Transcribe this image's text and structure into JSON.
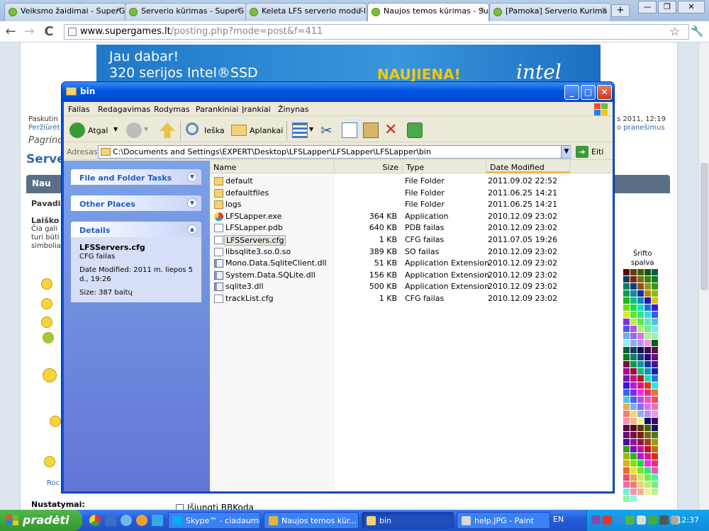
{
  "browser": {
    "tabs": [
      {
        "label": "Veiksmo žaidimai - SuperG",
        "active": false
      },
      {
        "label": "Serverio kūrimas - SuperG",
        "active": false
      },
      {
        "label": "Keleta LFS serverio modu-l",
        "active": false
      },
      {
        "label": "Naujos temos kūrimas - Su",
        "active": true
      },
      {
        "label": "[Pamoka] Serverio Kurima",
        "active": false
      }
    ],
    "newtab": "+",
    "window_min": "—",
    "window_max": "❐",
    "window_close": "✕",
    "back": "←",
    "forward": "→",
    "reload": "C",
    "url_host": "www.supergames.lt",
    "url_path": "/posting.php?mode=post&f=411",
    "star": "☆",
    "wrench": "🔧"
  },
  "page": {
    "banner_line1": "Jau dabar!",
    "banner_line2": "320 serijos Intel®SSD",
    "banner_naujiena": "NAUJIENA!",
    "banner_brand": "intel",
    "paskut": "Paskutin",
    "perziuret": "Peržiūrėt",
    "pagrind": "Pagrind",
    "datetime_right": "s 2011, 12:19",
    "pranesimus": "o pranešimus",
    "server_heading": "Server",
    "bar_label": "Nau",
    "pavad": "Pavadi",
    "laisko": "Laiško",
    "cia_gali": "Čia gali",
    "turi_buti": "turi būti",
    "simbolia": "simbolia",
    "roc": "Roc",
    "srifto": "Šrifto",
    "spalva": "spalva",
    "nustatymai": "Nustatymai:",
    "bbkoda": "Išjungti BBKodą"
  },
  "explorer": {
    "title": "bin",
    "menu": [
      "Failas",
      "Redagavimas",
      "Rodymas",
      "Parankiniai",
      "Įrankiai",
      "Žinynas"
    ],
    "toolbar": {
      "back": "Atgal",
      "search": "Ieška",
      "folders": "Aplankai"
    },
    "address_label": "Adresas",
    "address": "C:\\Documents and Settings\\EXPERT\\Desktop\\LFSLapper\\LFSLapper\\LFSLapper\\bin",
    "go": "Eiti",
    "tasks": {
      "file_folder": "File and Folder Tasks",
      "other_places": "Other Places",
      "details": "Details",
      "detail_name": "LFSServers.cfg",
      "detail_type": "CFG failas",
      "detail_modified": "Date Modified: 2011 m. liepos 5 d., 19:26",
      "detail_size": "Size: 387 baitų"
    },
    "columns": {
      "name": "Name",
      "size": "Size",
      "type": "Type",
      "date": "Date Modified"
    },
    "files": [
      {
        "name": "default",
        "size": "",
        "type": "File Folder",
        "date": "2011.09.02 22:52",
        "icon": "folder"
      },
      {
        "name": "defaultfiles",
        "size": "",
        "type": "File Folder",
        "date": "2011.06.25 14:21",
        "icon": "folder"
      },
      {
        "name": "logs",
        "size": "",
        "type": "File Folder",
        "date": "2011.06.25 14:21",
        "icon": "folder"
      },
      {
        "name": "LFSLapper.exe",
        "size": "364 KB",
        "type": "Application",
        "date": "2010.12.09 23:02",
        "icon": "exe"
      },
      {
        "name": "LFSLapper.pdb",
        "size": "640 KB",
        "type": "PDB failas",
        "date": "2010.12.09 23:02",
        "icon": "doc"
      },
      {
        "name": "LFSServers.cfg",
        "size": "1 KB",
        "type": "CFG failas",
        "date": "2011.07.05 19:26",
        "icon": "doc",
        "selected": true
      },
      {
        "name": "libsqlite3.so.0.so",
        "size": "389 KB",
        "type": "SO failas",
        "date": "2010.12.09 23:02",
        "icon": "doc"
      },
      {
        "name": "Mono.Data.SqliteClient.dll",
        "size": "51 KB",
        "type": "Application Extension",
        "date": "2010.12.09 23:02",
        "icon": "dll"
      },
      {
        "name": "System.Data.SQLite.dll",
        "size": "156 KB",
        "type": "Application Extension",
        "date": "2010.12.09 23:02",
        "icon": "dll"
      },
      {
        "name": "sqlite3.dll",
        "size": "500 KB",
        "type": "Application Extension",
        "date": "2010.12.09 23:02",
        "icon": "dll"
      },
      {
        "name": "trackList.cfg",
        "size": "1 KB",
        "type": "CFG failas",
        "date": "2010.12.09 23:02",
        "icon": "doc"
      }
    ]
  },
  "taskbar": {
    "start": "pradėti",
    "buttons": [
      {
        "label": "Skype™ - ciadaumis",
        "color": "#00aff0"
      },
      {
        "label": "Naujos temos kūr...",
        "color": "#e8b33a"
      },
      {
        "label": "bin",
        "color": "#f1d277",
        "active": true
      },
      {
        "label": "help.JPG - Paint",
        "color": "#d9d9d9"
      }
    ],
    "lang": "EN",
    "clock": "12:37"
  }
}
